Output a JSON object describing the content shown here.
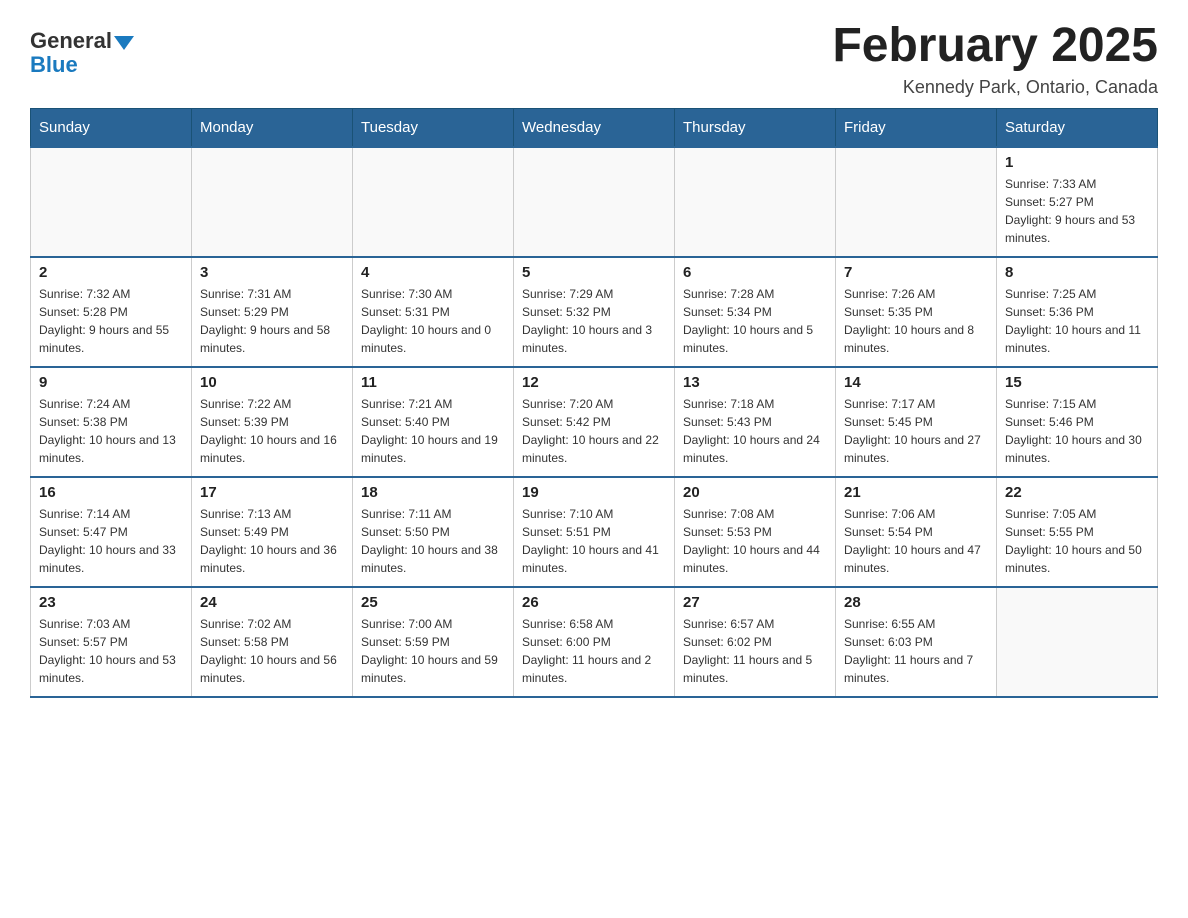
{
  "header": {
    "logo_general": "General",
    "logo_blue": "Blue",
    "month_title": "February 2025",
    "location": "Kennedy Park, Ontario, Canada"
  },
  "days_of_week": [
    "Sunday",
    "Monday",
    "Tuesday",
    "Wednesday",
    "Thursday",
    "Friday",
    "Saturday"
  ],
  "weeks": [
    [
      {
        "day": "",
        "info": ""
      },
      {
        "day": "",
        "info": ""
      },
      {
        "day": "",
        "info": ""
      },
      {
        "day": "",
        "info": ""
      },
      {
        "day": "",
        "info": ""
      },
      {
        "day": "",
        "info": ""
      },
      {
        "day": "1",
        "info": "Sunrise: 7:33 AM\nSunset: 5:27 PM\nDaylight: 9 hours and 53 minutes."
      }
    ],
    [
      {
        "day": "2",
        "info": "Sunrise: 7:32 AM\nSunset: 5:28 PM\nDaylight: 9 hours and 55 minutes."
      },
      {
        "day": "3",
        "info": "Sunrise: 7:31 AM\nSunset: 5:29 PM\nDaylight: 9 hours and 58 minutes."
      },
      {
        "day": "4",
        "info": "Sunrise: 7:30 AM\nSunset: 5:31 PM\nDaylight: 10 hours and 0 minutes."
      },
      {
        "day": "5",
        "info": "Sunrise: 7:29 AM\nSunset: 5:32 PM\nDaylight: 10 hours and 3 minutes."
      },
      {
        "day": "6",
        "info": "Sunrise: 7:28 AM\nSunset: 5:34 PM\nDaylight: 10 hours and 5 minutes."
      },
      {
        "day": "7",
        "info": "Sunrise: 7:26 AM\nSunset: 5:35 PM\nDaylight: 10 hours and 8 minutes."
      },
      {
        "day": "8",
        "info": "Sunrise: 7:25 AM\nSunset: 5:36 PM\nDaylight: 10 hours and 11 minutes."
      }
    ],
    [
      {
        "day": "9",
        "info": "Sunrise: 7:24 AM\nSunset: 5:38 PM\nDaylight: 10 hours and 13 minutes."
      },
      {
        "day": "10",
        "info": "Sunrise: 7:22 AM\nSunset: 5:39 PM\nDaylight: 10 hours and 16 minutes."
      },
      {
        "day": "11",
        "info": "Sunrise: 7:21 AM\nSunset: 5:40 PM\nDaylight: 10 hours and 19 minutes."
      },
      {
        "day": "12",
        "info": "Sunrise: 7:20 AM\nSunset: 5:42 PM\nDaylight: 10 hours and 22 minutes."
      },
      {
        "day": "13",
        "info": "Sunrise: 7:18 AM\nSunset: 5:43 PM\nDaylight: 10 hours and 24 minutes."
      },
      {
        "day": "14",
        "info": "Sunrise: 7:17 AM\nSunset: 5:45 PM\nDaylight: 10 hours and 27 minutes."
      },
      {
        "day": "15",
        "info": "Sunrise: 7:15 AM\nSunset: 5:46 PM\nDaylight: 10 hours and 30 minutes."
      }
    ],
    [
      {
        "day": "16",
        "info": "Sunrise: 7:14 AM\nSunset: 5:47 PM\nDaylight: 10 hours and 33 minutes."
      },
      {
        "day": "17",
        "info": "Sunrise: 7:13 AM\nSunset: 5:49 PM\nDaylight: 10 hours and 36 minutes."
      },
      {
        "day": "18",
        "info": "Sunrise: 7:11 AM\nSunset: 5:50 PM\nDaylight: 10 hours and 38 minutes."
      },
      {
        "day": "19",
        "info": "Sunrise: 7:10 AM\nSunset: 5:51 PM\nDaylight: 10 hours and 41 minutes."
      },
      {
        "day": "20",
        "info": "Sunrise: 7:08 AM\nSunset: 5:53 PM\nDaylight: 10 hours and 44 minutes."
      },
      {
        "day": "21",
        "info": "Sunrise: 7:06 AM\nSunset: 5:54 PM\nDaylight: 10 hours and 47 minutes."
      },
      {
        "day": "22",
        "info": "Sunrise: 7:05 AM\nSunset: 5:55 PM\nDaylight: 10 hours and 50 minutes."
      }
    ],
    [
      {
        "day": "23",
        "info": "Sunrise: 7:03 AM\nSunset: 5:57 PM\nDaylight: 10 hours and 53 minutes."
      },
      {
        "day": "24",
        "info": "Sunrise: 7:02 AM\nSunset: 5:58 PM\nDaylight: 10 hours and 56 minutes."
      },
      {
        "day": "25",
        "info": "Sunrise: 7:00 AM\nSunset: 5:59 PM\nDaylight: 10 hours and 59 minutes."
      },
      {
        "day": "26",
        "info": "Sunrise: 6:58 AM\nSunset: 6:00 PM\nDaylight: 11 hours and 2 minutes."
      },
      {
        "day": "27",
        "info": "Sunrise: 6:57 AM\nSunset: 6:02 PM\nDaylight: 11 hours and 5 minutes."
      },
      {
        "day": "28",
        "info": "Sunrise: 6:55 AM\nSunset: 6:03 PM\nDaylight: 11 hours and 7 minutes."
      },
      {
        "day": "",
        "info": ""
      }
    ]
  ]
}
